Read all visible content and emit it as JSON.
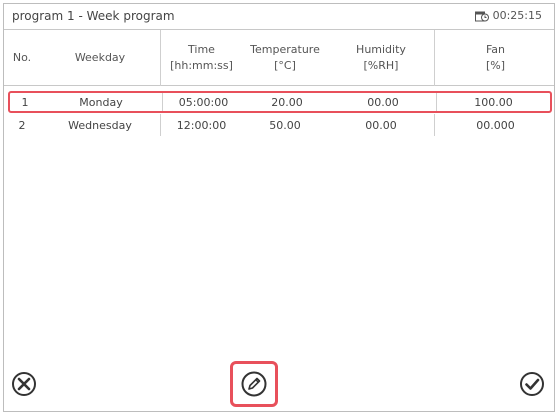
{
  "title": "program 1 - Week program",
  "clock": "00:25:15",
  "columns": [
    {
      "line1": "No.",
      "line2": ""
    },
    {
      "line1": "Weekday",
      "line2": ""
    },
    {
      "line1": "Time",
      "line2": "[hh:mm:ss]"
    },
    {
      "line1": "Temperature",
      "line2": "[°C]"
    },
    {
      "line1": "Humidity",
      "line2": "[%RH]"
    },
    {
      "line1": "Fan",
      "line2": "[%]"
    }
  ],
  "rows": [
    {
      "no": "1",
      "weekday": "Monday",
      "time": "05:00:00",
      "temperature": "20.00",
      "humidity": "00.00",
      "fan": "100.00"
    },
    {
      "no": "2",
      "weekday": "Wednesday",
      "time": "12:00:00",
      "temperature": "50.00",
      "humidity": "00.00",
      "fan": "00.000"
    }
  ],
  "icons": {
    "cancel": "cancel-icon",
    "edit": "pencil-icon",
    "confirm": "checkmark-icon"
  },
  "colors": {
    "highlight": "#e8505b"
  }
}
